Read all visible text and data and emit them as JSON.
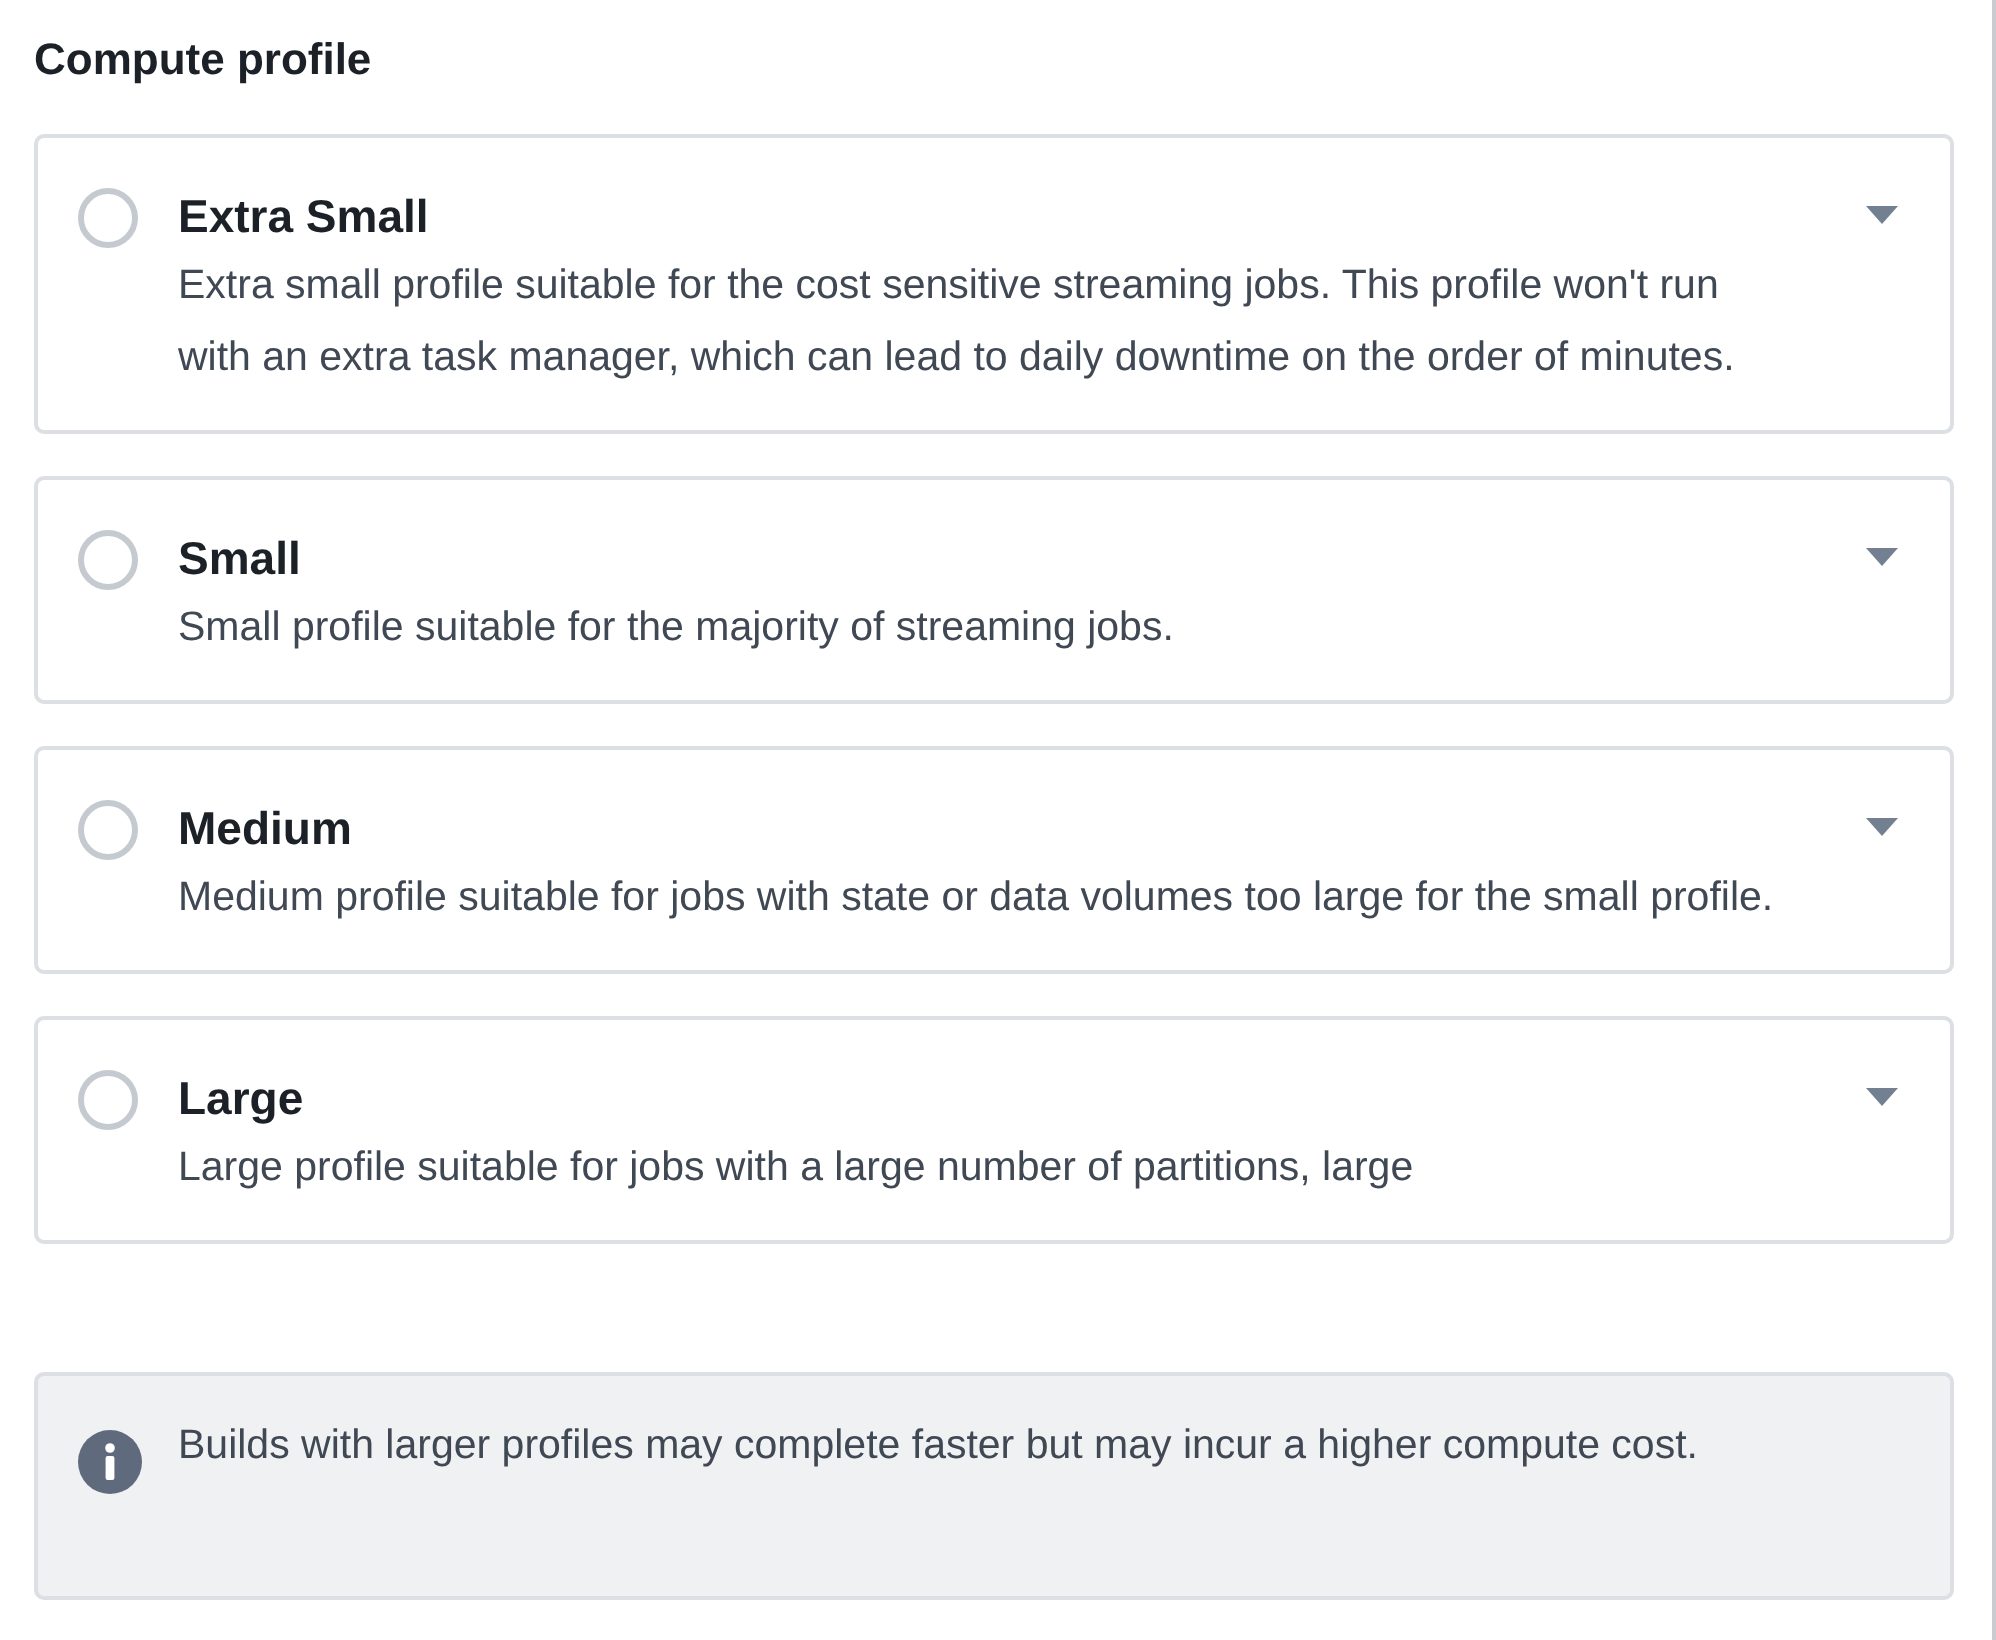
{
  "title": "Compute profile",
  "profiles": [
    {
      "name": "Extra Small",
      "description": "Extra small profile suitable for the cost sensitive streaming jobs. This profile won't run with an extra task manager, which can lead to daily downtime on the order of minutes.",
      "selected": false
    },
    {
      "name": "Small",
      "description": "Small profile suitable for the majority of streaming jobs.",
      "selected": false
    },
    {
      "name": "Medium",
      "description": "Medium profile suitable for jobs with state or data volumes too large for the small profile.",
      "selected": false
    },
    {
      "name": "Large",
      "description": "Large profile suitable for jobs with a large number of partitions, large",
      "selected": false
    }
  ],
  "info": {
    "text": "Builds with larger profiles may complete faster but may incur a higher compute cost."
  }
}
